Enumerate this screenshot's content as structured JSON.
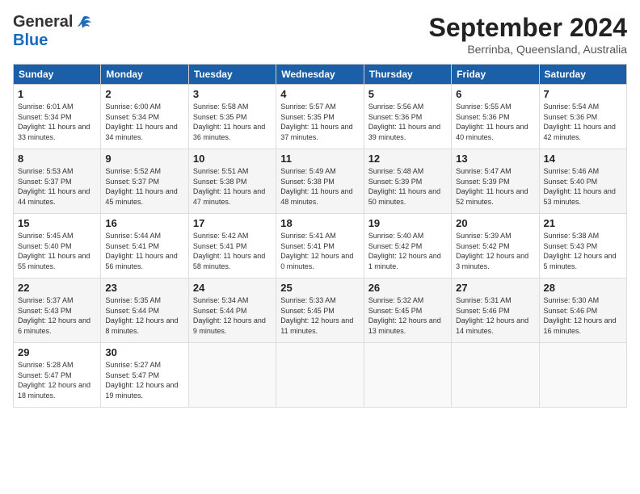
{
  "header": {
    "logo_general": "General",
    "logo_blue": "Blue",
    "title": "September 2024",
    "location": "Berrinba, Queensland, Australia"
  },
  "days_of_week": [
    "Sunday",
    "Monday",
    "Tuesday",
    "Wednesday",
    "Thursday",
    "Friday",
    "Saturday"
  ],
  "weeks": [
    [
      {
        "day": "1",
        "sunrise": "6:01 AM",
        "sunset": "5:34 PM",
        "daylight": "11 hours and 33 minutes."
      },
      {
        "day": "2",
        "sunrise": "6:00 AM",
        "sunset": "5:34 PM",
        "daylight": "11 hours and 34 minutes."
      },
      {
        "day": "3",
        "sunrise": "5:58 AM",
        "sunset": "5:35 PM",
        "daylight": "11 hours and 36 minutes."
      },
      {
        "day": "4",
        "sunrise": "5:57 AM",
        "sunset": "5:35 PM",
        "daylight": "11 hours and 37 minutes."
      },
      {
        "day": "5",
        "sunrise": "5:56 AM",
        "sunset": "5:36 PM",
        "daylight": "11 hours and 39 minutes."
      },
      {
        "day": "6",
        "sunrise": "5:55 AM",
        "sunset": "5:36 PM",
        "daylight": "11 hours and 40 minutes."
      },
      {
        "day": "7",
        "sunrise": "5:54 AM",
        "sunset": "5:36 PM",
        "daylight": "11 hours and 42 minutes."
      }
    ],
    [
      {
        "day": "8",
        "sunrise": "5:53 AM",
        "sunset": "5:37 PM",
        "daylight": "11 hours and 44 minutes."
      },
      {
        "day": "9",
        "sunrise": "5:52 AM",
        "sunset": "5:37 PM",
        "daylight": "11 hours and 45 minutes."
      },
      {
        "day": "10",
        "sunrise": "5:51 AM",
        "sunset": "5:38 PM",
        "daylight": "11 hours and 47 minutes."
      },
      {
        "day": "11",
        "sunrise": "5:49 AM",
        "sunset": "5:38 PM",
        "daylight": "11 hours and 48 minutes."
      },
      {
        "day": "12",
        "sunrise": "5:48 AM",
        "sunset": "5:39 PM",
        "daylight": "11 hours and 50 minutes."
      },
      {
        "day": "13",
        "sunrise": "5:47 AM",
        "sunset": "5:39 PM",
        "daylight": "11 hours and 52 minutes."
      },
      {
        "day": "14",
        "sunrise": "5:46 AM",
        "sunset": "5:40 PM",
        "daylight": "11 hours and 53 minutes."
      }
    ],
    [
      {
        "day": "15",
        "sunrise": "5:45 AM",
        "sunset": "5:40 PM",
        "daylight": "11 hours and 55 minutes."
      },
      {
        "day": "16",
        "sunrise": "5:44 AM",
        "sunset": "5:41 PM",
        "daylight": "11 hours and 56 minutes."
      },
      {
        "day": "17",
        "sunrise": "5:42 AM",
        "sunset": "5:41 PM",
        "daylight": "11 hours and 58 minutes."
      },
      {
        "day": "18",
        "sunrise": "5:41 AM",
        "sunset": "5:41 PM",
        "daylight": "12 hours and 0 minutes."
      },
      {
        "day": "19",
        "sunrise": "5:40 AM",
        "sunset": "5:42 PM",
        "daylight": "12 hours and 1 minute."
      },
      {
        "day": "20",
        "sunrise": "5:39 AM",
        "sunset": "5:42 PM",
        "daylight": "12 hours and 3 minutes."
      },
      {
        "day": "21",
        "sunrise": "5:38 AM",
        "sunset": "5:43 PM",
        "daylight": "12 hours and 5 minutes."
      }
    ],
    [
      {
        "day": "22",
        "sunrise": "5:37 AM",
        "sunset": "5:43 PM",
        "daylight": "12 hours and 6 minutes."
      },
      {
        "day": "23",
        "sunrise": "5:35 AM",
        "sunset": "5:44 PM",
        "daylight": "12 hours and 8 minutes."
      },
      {
        "day": "24",
        "sunrise": "5:34 AM",
        "sunset": "5:44 PM",
        "daylight": "12 hours and 9 minutes."
      },
      {
        "day": "25",
        "sunrise": "5:33 AM",
        "sunset": "5:45 PM",
        "daylight": "12 hours and 11 minutes."
      },
      {
        "day": "26",
        "sunrise": "5:32 AM",
        "sunset": "5:45 PM",
        "daylight": "12 hours and 13 minutes."
      },
      {
        "day": "27",
        "sunrise": "5:31 AM",
        "sunset": "5:46 PM",
        "daylight": "12 hours and 14 minutes."
      },
      {
        "day": "28",
        "sunrise": "5:30 AM",
        "sunset": "5:46 PM",
        "daylight": "12 hours and 16 minutes."
      }
    ],
    [
      {
        "day": "29",
        "sunrise": "5:28 AM",
        "sunset": "5:47 PM",
        "daylight": "12 hours and 18 minutes."
      },
      {
        "day": "30",
        "sunrise": "5:27 AM",
        "sunset": "5:47 PM",
        "daylight": "12 hours and 19 minutes."
      },
      null,
      null,
      null,
      null,
      null
    ]
  ]
}
